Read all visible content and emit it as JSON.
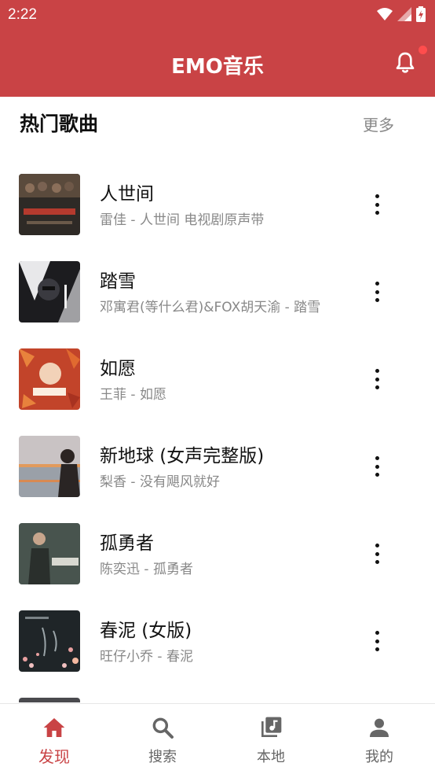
{
  "status_bar": {
    "time": "2:22"
  },
  "app": {
    "title": "EMO音乐",
    "accent_color": "#c94345"
  },
  "section": {
    "title": "热门歌曲",
    "more_label": "更多"
  },
  "songs": [
    {
      "title": "人世间",
      "subtitle": "雷佳 - 人世间 电视剧原声带"
    },
    {
      "title": "踏雪",
      "subtitle": "邓寓君(等什么君)&FOX胡天渝 - 踏雪"
    },
    {
      "title": "如愿",
      "subtitle": "王菲 - 如愿"
    },
    {
      "title": "新地球 (女声完整版)",
      "subtitle": "梨香 - 没有飓风就好"
    },
    {
      "title": "孤勇者",
      "subtitle": "陈奕迅 - 孤勇者"
    },
    {
      "title": "春泥 (女版)",
      "subtitle": "旺仔小乔 - 春泥"
    }
  ],
  "bottom_nav": {
    "items": [
      {
        "label": "发现",
        "icon": "home-icon",
        "active": true
      },
      {
        "label": "搜索",
        "icon": "search-icon",
        "active": false
      },
      {
        "label": "本地",
        "icon": "music-library-icon",
        "active": false
      },
      {
        "label": "我的",
        "icon": "person-icon",
        "active": false
      }
    ]
  }
}
